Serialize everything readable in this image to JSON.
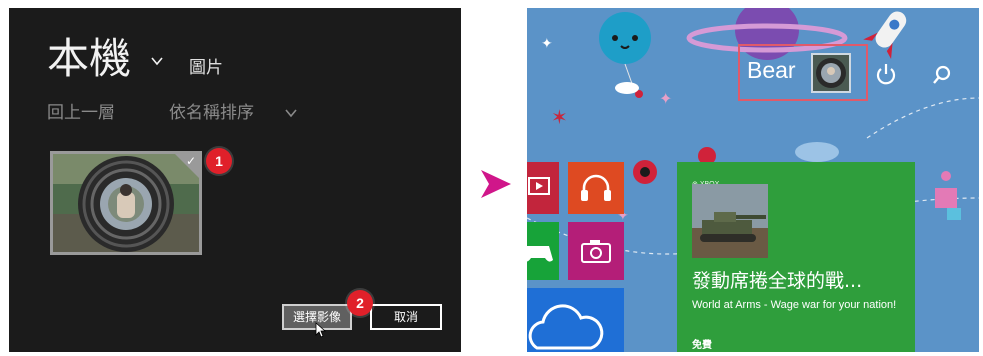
{
  "picker": {
    "location_title": "本機",
    "location_subfolder": "圖片",
    "nav_up": "回上一層",
    "sort_label": "依名稱排序",
    "step_badge_1": "1",
    "step_badge_2": "2",
    "select_button": "選擇影像",
    "cancel_button": "取消"
  },
  "start": {
    "user_name": "Bear",
    "xbox_tile": {
      "brand": "XBOX",
      "title": "發動席捲全球的戰...",
      "description": "World at Arms - Wage war for your nation!",
      "price": "免費"
    }
  },
  "colors": {
    "picker_bg": "#1b1b1b",
    "start_bg": "#5b93c8",
    "highlight_frame": "#e05a6a",
    "badge": "#e0202a",
    "arrow": "#d0168a",
    "xbox_green": "#2f9e3c"
  },
  "icons": [
    "chevron-down-icon",
    "checkmark-icon",
    "mouse-cursor-icon",
    "arrow-right-icon",
    "power-icon",
    "search-icon",
    "video-icon",
    "headphones-icon",
    "gamepad-icon",
    "camera-icon",
    "cloud-icon",
    "xbox-icon"
  ]
}
